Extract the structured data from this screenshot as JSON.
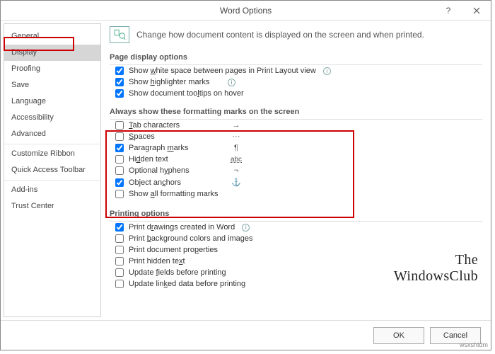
{
  "title": "Word Options",
  "sidebar": {
    "items": [
      {
        "label": "General"
      },
      {
        "label": "Display",
        "selected": true
      },
      {
        "label": "Proofing"
      },
      {
        "label": "Save"
      },
      {
        "label": "Language"
      },
      {
        "label": "Accessibility"
      },
      {
        "label": "Advanced"
      },
      {
        "label": "Customize Ribbon"
      },
      {
        "label": "Quick Access Toolbar"
      },
      {
        "label": "Add-ins"
      },
      {
        "label": "Trust Center"
      }
    ]
  },
  "header": {
    "text": "Change how document content is displayed on the screen and when printed."
  },
  "sections": {
    "page_display": {
      "title": "Page display options",
      "opts": [
        {
          "label_pre": "Show ",
          "key": "w",
          "label_post": "hite space between pages in Print Layout view",
          "checked": true,
          "info": true
        },
        {
          "label_pre": "Show ",
          "key": "h",
          "label_post": "ighlighter marks",
          "checked": true,
          "info": true
        },
        {
          "label_pre": "Show document too",
          "key": "l",
          "label_post": "tips on hover",
          "checked": true
        }
      ]
    },
    "formatting_marks": {
      "title": "Always show these formatting marks on the screen",
      "opts": [
        {
          "key": "T",
          "label_post": "ab characters",
          "checked": false,
          "symbol": "→"
        },
        {
          "key": "S",
          "label_post": "paces",
          "checked": false,
          "symbol": "···"
        },
        {
          "label_pre": "Paragraph ",
          "key": "m",
          "label_post": "arks",
          "checked": true,
          "symbol": "¶"
        },
        {
          "label_pre": "Hi",
          "key": "d",
          "label_post": "den text",
          "checked": false,
          "symbol": "abc"
        },
        {
          "label_pre": "Optional h",
          "key": "y",
          "label_post": "phens",
          "checked": false,
          "symbol": "¬"
        },
        {
          "label_pre": "Object an",
          "key": "c",
          "label_post": "hors",
          "checked": true,
          "symbol": "⚓"
        },
        {
          "label_pre": "Show ",
          "key": "a",
          "label_post": "ll formatting marks",
          "checked": false
        }
      ]
    },
    "printing": {
      "title": "Printing options",
      "opts": [
        {
          "label_pre": "Print d",
          "key": "r",
          "label_post": "awings created in Word",
          "checked": true,
          "info": true
        },
        {
          "label_pre": "Print ",
          "key": "b",
          "label_post": "ackground colors and images",
          "checked": false
        },
        {
          "label_pre": "Print document pro",
          "key": "p",
          "label_post": "erties",
          "checked": false
        },
        {
          "label_pre": "Print hidden te",
          "key": "x",
          "label_post": "t",
          "checked": false
        },
        {
          "label_pre": "Update ",
          "key": "f",
          "label_post": "ields before printing",
          "checked": false
        },
        {
          "label_pre": "Update lin",
          "key": "k",
          "label_post": "ed data before printing",
          "checked": false
        }
      ]
    }
  },
  "footer": {
    "ok": "OK",
    "cancel": "Cancel"
  },
  "watermark": {
    "l1": "The",
    "l2": "WindowsClub"
  },
  "corner": "wsxshtdm"
}
